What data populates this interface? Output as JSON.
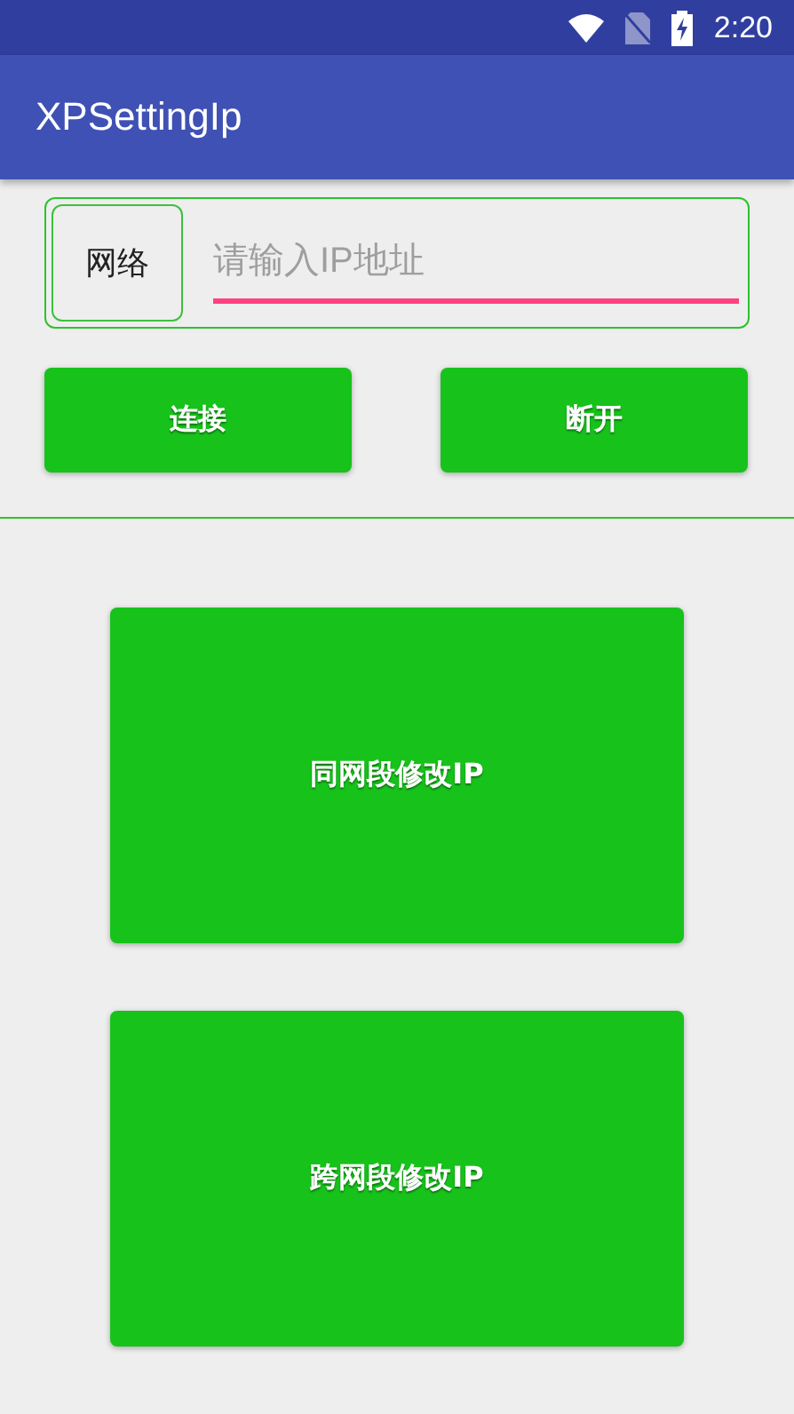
{
  "status_bar": {
    "time": "2:20"
  },
  "app_bar": {
    "title": "XPSettingIp"
  },
  "ip_form": {
    "label": "网络",
    "placeholder": "请输入IP地址"
  },
  "buttons": [
    {
      "label": "连接"
    },
    {
      "label": "断开"
    }
  ],
  "actions": [
    {
      "label": "同网段修改IP"
    },
    {
      "label": "跨网段修改IP"
    }
  ]
}
